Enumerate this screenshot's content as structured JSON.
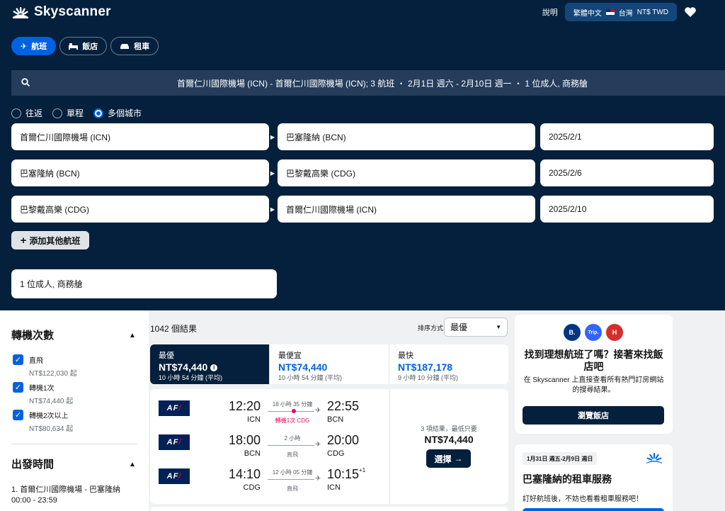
{
  "header": {
    "brand": "Skyscanner",
    "help": "說明",
    "locale": {
      "language": "繁體中文",
      "region": "台灣",
      "currency": "NT$ TWD"
    }
  },
  "tabs": [
    {
      "label": "航班",
      "icon": "plane-icon",
      "active": true
    },
    {
      "label": "飯店",
      "icon": "bed-icon",
      "active": false
    },
    {
      "label": "租車",
      "icon": "car-icon",
      "active": false
    }
  ],
  "search_summary": "首爾仁川國際機場 (ICN) - 首爾仁川國際機場 (ICN); 3 航班 ・ 2月1日 週六 - 2月10日 週一 ・ 1 位成人, 商務艙",
  "trip_types": [
    {
      "label": "往返",
      "selected": false
    },
    {
      "label": "單程",
      "selected": false
    },
    {
      "label": "多個城市",
      "selected": true
    }
  ],
  "legs": [
    {
      "from": "首爾仁川國際機場 (ICN)",
      "to": "巴塞隆納 (BCN)",
      "date": "2025/2/1"
    },
    {
      "from": "巴塞隆納 (BCN)",
      "to": "巴黎戴高樂 (CDG)",
      "date": "2025/2/6"
    },
    {
      "from": "巴黎戴高樂 (CDG)",
      "to": "首爾仁川國際機場 (ICN)",
      "date": "2025/2/10"
    }
  ],
  "add_flight": "添加其他航班",
  "passengers": "1 位成人, 商務艙",
  "filters": {
    "stops_title": "轉機次數",
    "stops": [
      {
        "label": "直飛",
        "price": "NT$122,030 起",
        "checked": true
      },
      {
        "label": "轉機1次",
        "price": "NT$74,440 起",
        "checked": true
      },
      {
        "label": "轉機2次以上",
        "price": "NT$80,634 起",
        "checked": true
      }
    ],
    "time_title": "出發時間",
    "time_route": "1. 首爾仁川國際機場 - 巴塞隆納",
    "time_range": "00:00 - 23:59"
  },
  "results": {
    "count": "1042 個結果",
    "sort_label": "排序方式",
    "sort_value": "最優",
    "sort_tabs": [
      {
        "title": "最優",
        "price": "NT$74,440",
        "duration": "10 小時 54 分鐘 (平均)",
        "active": true
      },
      {
        "title": "最便宜",
        "price": "NT$74,440",
        "duration": "10 小時 54 分鐘 (平均)",
        "active": false
      },
      {
        "title": "最快",
        "price": "NT$187,178",
        "duration": "9 小時 10 分鐘 (平均)",
        "active": false
      }
    ],
    "card": {
      "airline": "AF",
      "legs": [
        {
          "dep_time": "12:20",
          "dep_code": "ICN",
          "arr_time": "22:55",
          "arr_code": "BCN",
          "duration": "18 小時 35 分鐘",
          "stops": "轉機1次 CDG",
          "next_day": ""
        },
        {
          "dep_time": "18:00",
          "dep_code": "BCN",
          "arr_time": "20:00",
          "arr_code": "CDG",
          "duration": "2 小時",
          "stops": "直飛",
          "next_day": ""
        },
        {
          "dep_time": "14:10",
          "dep_code": "CDG",
          "arr_time": "10:15",
          "arr_code": "ICN",
          "duration": "12 小時 05 分鐘",
          "stops": "直飛",
          "next_day": "+1"
        }
      ],
      "deals": "3 項結果，最低只要",
      "price": "NT$74,440",
      "select": "選擇"
    }
  },
  "hotel_ad": {
    "title": "找到理想航班了嗎？接著來找飯店吧",
    "desc": "在 Skyscanner 上直接查看所有熱門訂房網站的搜尋結果。",
    "button": "瀏覽飯店",
    "logos": [
      {
        "text": "B.",
        "color": "#003580"
      },
      {
        "text": "Trip.",
        "color": "#3264ff"
      },
      {
        "text": "H",
        "color": "#d32f2f"
      }
    ]
  },
  "car_ad": {
    "dates": "1月31日 週五-2月9日 週日",
    "title": "巴塞隆納的租車服務",
    "desc": "訂好航班後，不妨也看看租車服務吧！"
  }
}
